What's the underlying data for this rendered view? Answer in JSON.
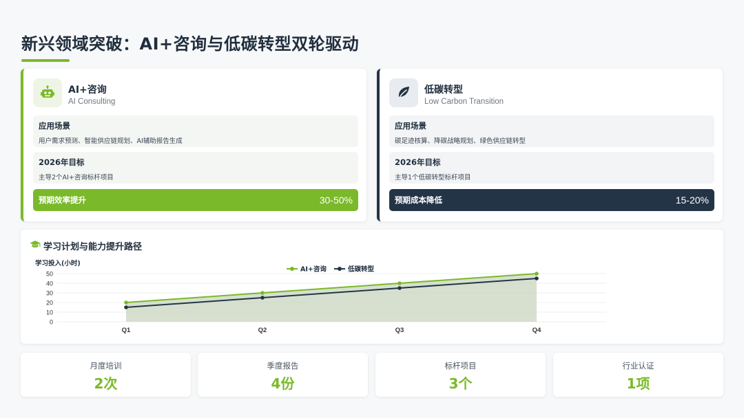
{
  "page": {
    "title": "新兴领域突破：AI+咨询与低碳转型双轮驱动"
  },
  "cards": [
    {
      "icon": "robot-icon",
      "title": "AI+咨询",
      "subtitle": "AI Consulting",
      "section1_heading": "应用场景",
      "section1_text": "用户需求预测、智能供应链规划、AI辅助报告生成",
      "section2_heading": "2026年目标",
      "section2_text": "主导2个AI+咨询标杆项目",
      "bar_label": "预期效率提升",
      "bar_value": "30-50%",
      "accent": "#7ab929"
    },
    {
      "icon": "leaf-icon",
      "title": "低碳转型",
      "subtitle": "Low Carbon Transition",
      "section1_heading": "应用场景",
      "section1_text": "碳足迹核算、降碳战略规划、绿色供应链转型",
      "section2_heading": "2026年目标",
      "section2_text": "主导1个低碳转型标杆项目",
      "bar_label": "预期成本降低",
      "bar_value": "15-20%",
      "accent": "#243447"
    }
  ],
  "chart_section": {
    "title": "学习计划与能力提升路径",
    "icon": "graduation-cap-icon"
  },
  "chart_data": {
    "type": "line",
    "title": "",
    "ylabel": "学习投入(小时)",
    "xlabel": "",
    "categories": [
      "Q1",
      "Q2",
      "Q3",
      "Q4"
    ],
    "ylim": [
      0,
      50
    ],
    "yticks": [
      0,
      10,
      20,
      30,
      40,
      50
    ],
    "grid": true,
    "legend": "top-center",
    "series": [
      {
        "name": "AI+咨询",
        "values": [
          20,
          30,
          40,
          50
        ],
        "color": "#7ab929"
      },
      {
        "name": "低碳转型",
        "values": [
          15,
          25,
          35,
          45
        ],
        "color": "#243447"
      }
    ]
  },
  "stats": [
    {
      "label": "月度培训",
      "value": "2次"
    },
    {
      "label": "季度报告",
      "value": "4份"
    },
    {
      "label": "标杆项目",
      "value": "3个"
    },
    {
      "label": "行业认证",
      "value": "1项"
    }
  ]
}
